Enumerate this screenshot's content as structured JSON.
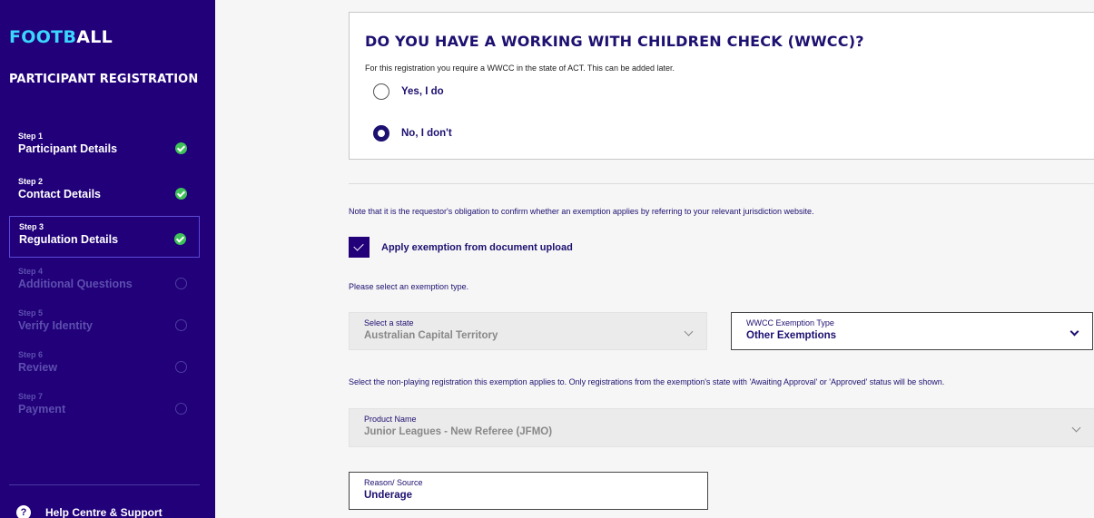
{
  "sidebar": {
    "logo_part1": "FOOTB",
    "logo_part2": "ALL",
    "title": "PARTICIPANT REGISTRATION",
    "steps": [
      {
        "num": "Step 1",
        "label": "Participant Details",
        "status": "done"
      },
      {
        "num": "Step 2",
        "label": "Contact Details",
        "status": "done"
      },
      {
        "num": "Step 3",
        "label": "Regulation Details",
        "status": "done"
      },
      {
        "num": "Step 4",
        "label": "Additional Questions",
        "status": "pending"
      },
      {
        "num": "Step 5",
        "label": "Verify Identity",
        "status": "pending"
      },
      {
        "num": "Step 6",
        "label": "Review",
        "status": "pending"
      },
      {
        "num": "Step 7",
        "label": "Payment",
        "status": "pending"
      }
    ],
    "help_label": "Help Centre & Support",
    "help_icon": "?"
  },
  "wwcc": {
    "title": "DO YOU HAVE A WORKING WITH CHILDREN CHECK (WWCC)?",
    "note": "For this registration you require a WWCC in the state of ACT. This can be added later.",
    "option_yes": "Yes, I do",
    "option_no": "No, I don't",
    "selected": "no"
  },
  "exemption": {
    "note": "Note that it is the requestor's obligation to confirm whether an exemption applies by referring to your relevant jurisdiction website.",
    "checkbox_label": "Apply exemption from document upload",
    "checked": true,
    "type_prompt": "Please select an exemption type.",
    "state_label": "Select a state",
    "state_value": "Australian Capital Territory",
    "type_label": "WWCC Exemption Type",
    "type_value": "Other Exemptions",
    "registration_prompt": "Select the non-playing registration this exemption applies to. Only registrations from the exemption's state with 'Awaiting Approval' or 'Approved' status will be shown.",
    "product_label": "Product Name",
    "product_value": "Junior Leagues - New Referee (JFMO)",
    "reason_label": "Reason/ Source",
    "reason_value": "Underage"
  },
  "colors": {
    "sidebar_bg": "#21007a",
    "accent_cyan": "#3ad6ff",
    "heading": "#1c1070",
    "success": "#3fc15a"
  }
}
